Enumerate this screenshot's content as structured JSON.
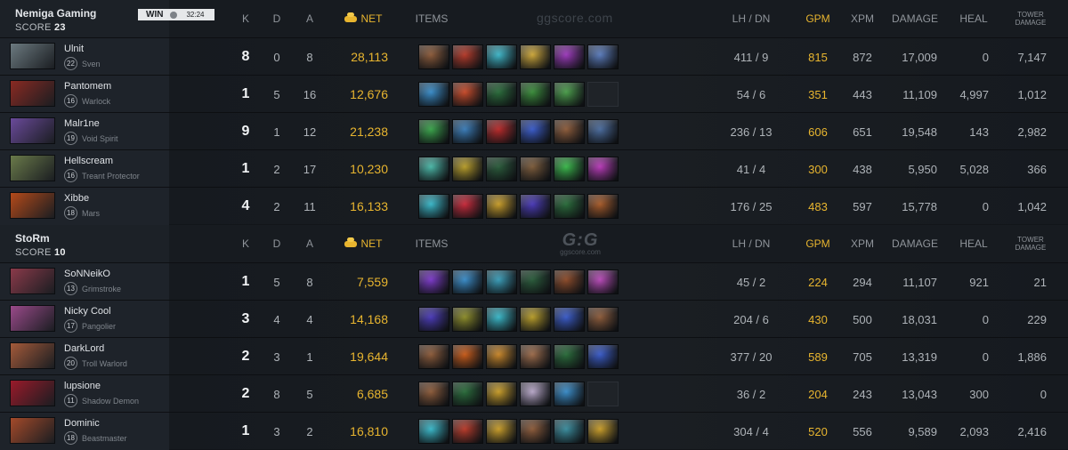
{
  "columns": {
    "k": "K",
    "d": "D",
    "a": "A",
    "net": "NET",
    "items": "ITEMS",
    "lh_dn": "LH / DN",
    "gpm": "GPM",
    "xpm": "XPM",
    "damage": "DAMAGE",
    "heal": "HEAL",
    "tower_damage_1": "TOWER",
    "tower_damage_2": "DAMAGE"
  },
  "watermark": "ggscore.com",
  "logo": {
    "big": "G:G",
    "small": "ggscore.com"
  },
  "teams": [
    {
      "name": "Nemiga Gaming",
      "score_label": "SCORE",
      "score": "23",
      "result": "WIN",
      "duration": "32:24",
      "players": [
        {
          "name": "Ulnit",
          "level": "22",
          "hero": "Sven",
          "k": "8",
          "d": "0",
          "a": "8",
          "net": "28,113",
          "lh_dn": "411 / 9",
          "gpm": "815",
          "xpm": "872",
          "damage": "17,009",
          "heal": "0",
          "tower": "7,147",
          "avatar_color": "#6c7a80",
          "items": [
            "#8a5a3a",
            "#b23a2a",
            "#3fb3c4",
            "#c9a43a",
            "#9a3ab8",
            "#5a7ab8"
          ]
        },
        {
          "name": "Pantomem",
          "level": "16",
          "hero": "Warlock",
          "k": "1",
          "d": "5",
          "a": "16",
          "net": "12,676",
          "lh_dn": "54 / 6",
          "gpm": "351",
          "xpm": "443",
          "damage": "11,109",
          "heal": "4,997",
          "tower": "1,012",
          "avatar_color": "#8a2a22",
          "items": [
            "#3a8ac4",
            "#c44a2a",
            "#2a6a3a",
            "#3a8a3a",
            "#4a9a4a",
            ""
          ]
        },
        {
          "name": "Malr1ne",
          "level": "19",
          "hero": "Void Spirit",
          "k": "9",
          "d": "1",
          "a": "12",
          "net": "21,238",
          "lh_dn": "236 / 13",
          "gpm": "606",
          "xpm": "651",
          "damage": "19,548",
          "heal": "143",
          "tower": "2,982",
          "avatar_color": "#6a4a9a",
          "items": [
            "#3aa04a",
            "#3a7ab4",
            "#b42a2a",
            "#3a5ac4",
            "#8a5a3a",
            "#4a6a9a"
          ]
        },
        {
          "name": "Hellscream",
          "level": "16",
          "hero": "Treant Protector",
          "k": "1",
          "d": "2",
          "a": "17",
          "net": "10,230",
          "lh_dn": "41 / 4",
          "gpm": "300",
          "xpm": "438",
          "damage": "5,950",
          "heal": "5,028",
          "tower": "366",
          "avatar_color": "#6a7a4a",
          "items": [
            "#4ab4a4",
            "#b49a2a",
            "#2a5a3a",
            "#7a5a3a",
            "#3ab44a",
            "#b43ab4"
          ]
        },
        {
          "name": "Xibbe",
          "level": "18",
          "hero": "Mars",
          "k": "4",
          "d": "2",
          "a": "11",
          "net": "16,133",
          "lh_dn": "176 / 25",
          "gpm": "483",
          "xpm": "597",
          "damage": "15,778",
          "heal": "0",
          "tower": "1,042",
          "avatar_color": "#b44a1a",
          "items": [
            "#3ab4c4",
            "#c42a3a",
            "#c49a2a",
            "#4a3ab4",
            "#2a6a3a",
            "#a45a2a"
          ]
        }
      ]
    },
    {
      "name": "StoRm",
      "score_label": "SCORE",
      "score": "10",
      "players": [
        {
          "name": "SoNNeikO",
          "level": "13",
          "hero": "Grimstroke",
          "k": "1",
          "d": "5",
          "a": "8",
          "net": "7,559",
          "lh_dn": "45 / 2",
          "gpm": "224",
          "xpm": "294",
          "damage": "11,107",
          "heal": "921",
          "tower": "21",
          "avatar_color": "#8a3a4a",
          "items": [
            "#7a3ac4",
            "#3a8ac4",
            "#3a9ab4",
            "#2a5a3a",
            "#8a4a2a",
            "#b44ab4"
          ]
        },
        {
          "name": "Nicky Cool",
          "level": "17",
          "hero": "Pangolier",
          "k": "3",
          "d": "4",
          "a": "4",
          "net": "14,168",
          "lh_dn": "204 / 6",
          "gpm": "430",
          "xpm": "500",
          "damage": "18,031",
          "heal": "0",
          "tower": "229",
          "avatar_color": "#9a4a8a",
          "items": [
            "#4a3ab4",
            "#8a8a2a",
            "#3ab4c4",
            "#b49a2a",
            "#3a5ac4",
            "#8a5a3a"
          ]
        },
        {
          "name": "DarkLord",
          "level": "20",
          "hero": "Troll Warlord",
          "k": "2",
          "d": "3",
          "a": "1",
          "net": "19,644",
          "lh_dn": "377 / 20",
          "gpm": "589",
          "xpm": "705",
          "damage": "13,319",
          "heal": "0",
          "tower": "1,886",
          "avatar_color": "#a45a3a",
          "items": [
            "#8a5a3a",
            "#c45a1a",
            "#c4842a",
            "#9a6a4a",
            "#2a6a3a",
            "#3a5ac4"
          ]
        },
        {
          "name": "lupsione",
          "level": "11",
          "hero": "Shadow Demon",
          "k": "2",
          "d": "8",
          "a": "5",
          "net": "6,685",
          "lh_dn": "36 / 2",
          "gpm": "204",
          "xpm": "243",
          "damage": "13,043",
          "heal": "300",
          "tower": "0",
          "avatar_color": "#9a1a2a",
          "items": [
            "#8a5a3a",
            "#2a6a3a",
            "#c49a2a",
            "#b4a4c4",
            "#3a8ac4",
            ""
          ]
        },
        {
          "name": "Dominic",
          "level": "18",
          "hero": "Beastmaster",
          "k": "1",
          "d": "3",
          "a": "2",
          "net": "16,810",
          "lh_dn": "304 / 4",
          "gpm": "520",
          "xpm": "556",
          "damage": "9,589",
          "heal": "2,093",
          "tower": "2,416",
          "avatar_color": "#a44a2a",
          "items": [
            "#3ab4c4",
            "#b43a2a",
            "#c49a2a",
            "#8a5a3a",
            "#3a8a9a",
            "#c49a2a"
          ]
        }
      ]
    }
  ]
}
